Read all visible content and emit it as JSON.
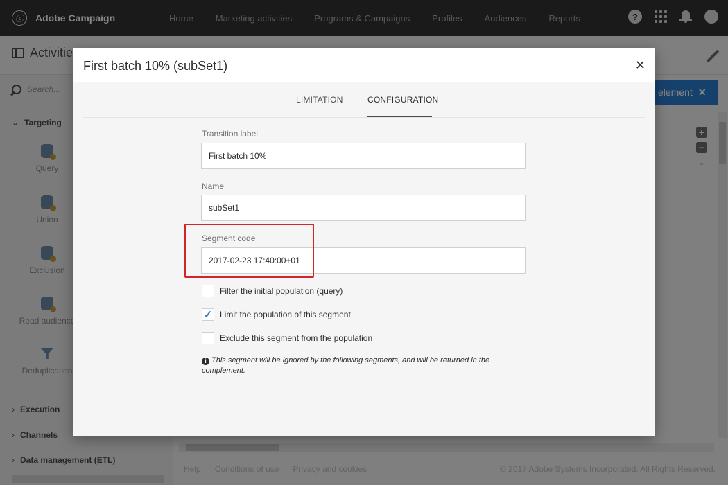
{
  "app": {
    "title": "Adobe Campaign",
    "nav": [
      "Home",
      "Marketing activities",
      "Programs & Campaigns",
      "Profiles",
      "Audiences",
      "Reports"
    ]
  },
  "background": {
    "page_title": "Activities",
    "search_placeholder": "Search...",
    "categories": {
      "targeting": "Targeting",
      "execution": "Execution",
      "channels": "Channels",
      "data_management": "Data management (ETL)"
    },
    "activities": [
      "Query",
      "Union",
      "Exclusion",
      "Read audience",
      "Deduplication"
    ],
    "action_button": "element",
    "footer_links": [
      "Help",
      "Conditions of use",
      "Privacy and cookies"
    ],
    "copyright": "© 2017 Adobe Systems Incorporated. All Rights Reserved."
  },
  "dialog": {
    "title": "First batch 10% (subSet1)",
    "tabs": [
      "LIMITATION",
      "CONFIGURATION"
    ],
    "active_tab": "CONFIGURATION",
    "fields": {
      "transition_label": {
        "label": "Transition label",
        "value": "First batch 10%"
      },
      "name": {
        "label": "Name",
        "value": "subSet1"
      },
      "segment_code": {
        "label": "Segment code",
        "value": "2017-02-23 17:40:00+01"
      }
    },
    "checkboxes": [
      {
        "label": "Filter the initial population (query)",
        "checked": false
      },
      {
        "label": "Limit the population of this segment",
        "checked": true
      },
      {
        "label": "Exclude this segment from the population",
        "checked": false
      }
    ],
    "note": "This segment will be ignored by the following segments, and will be returned in the complement."
  },
  "colors": {
    "topbar": "#323232",
    "accent_blue": "#2d7dd2",
    "highlight_red": "#d0262a"
  }
}
